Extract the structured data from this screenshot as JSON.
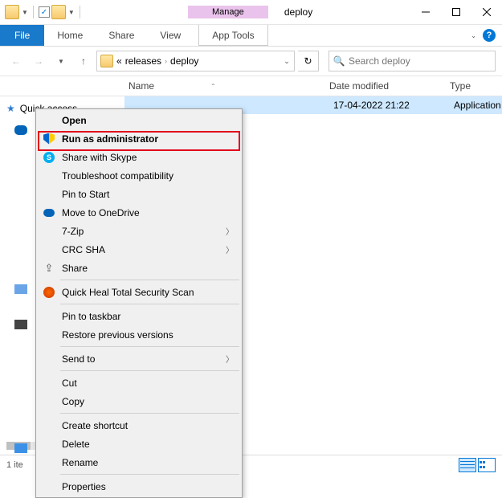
{
  "titlebar": {
    "manage": "Manage",
    "title": "deploy"
  },
  "ribbon": {
    "file": "File",
    "home": "Home",
    "share": "Share",
    "view": "View",
    "apptools": "App Tools"
  },
  "address": {
    "crumbs": [
      "releases",
      "deploy"
    ]
  },
  "search": {
    "placeholder": "Search deploy"
  },
  "columns": {
    "name": "Name",
    "date": "Date modified",
    "type": "Type"
  },
  "sidebar": {
    "quick": "Quick access"
  },
  "file_row": {
    "date": "17-04-2022 21:22",
    "type": "Application"
  },
  "context": {
    "open": "Open",
    "runadmin": "Run as administrator",
    "skype": "Share with Skype",
    "troubleshoot": "Troubleshoot compatibility",
    "pinstart": "Pin to Start",
    "onedrive": "Move to OneDrive",
    "sevenzip": "7-Zip",
    "crc": "CRC SHA",
    "share": "Share",
    "quickheal": "Quick Heal Total Security Scan",
    "pintaskbar": "Pin to taskbar",
    "restore": "Restore previous versions",
    "sendto": "Send to",
    "cut": "Cut",
    "copy": "Copy",
    "shortcut": "Create shortcut",
    "delete": "Delete",
    "rename": "Rename",
    "properties": "Properties"
  },
  "status": {
    "count": "1 ite"
  }
}
